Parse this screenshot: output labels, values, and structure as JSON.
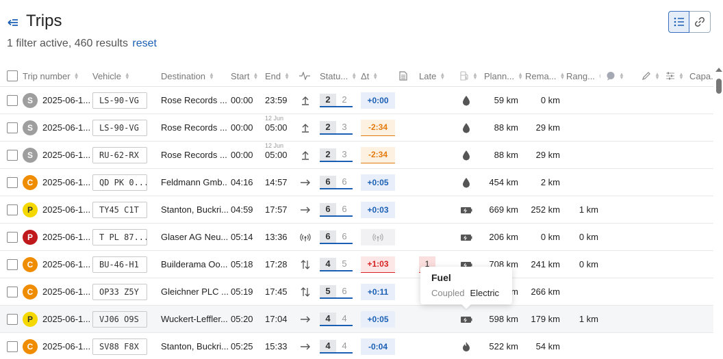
{
  "title": "Trips",
  "summary": {
    "filter_text": "1 filter active, 460 results",
    "reset_label": "reset"
  },
  "columns": {
    "trip_number": "Trip number",
    "vehicle": "Vehicle",
    "destination": "Destination",
    "start": "Start",
    "end": "End",
    "status": "Statu...",
    "delta": "Δt",
    "late": "Late",
    "planned": "Plann...",
    "remaining": "Rema...",
    "range": "Rang...",
    "capacity": "Capa..."
  },
  "rows": [
    {
      "badge": "S",
      "trip": "2025-06-1...",
      "plate": "LS-90-VG",
      "dest": "Rose Records ...",
      "start": "00:00",
      "end": "23:59",
      "end_date": "",
      "dir": "up",
      "s1": "2",
      "s2": "2",
      "delta": "+0:00",
      "delta_kind": "pos",
      "late": "",
      "fuel": "drop",
      "planned": "59 km",
      "remaining": "0 km",
      "range": ""
    },
    {
      "badge": "S",
      "trip": "2025-06-1...",
      "plate": "LS-90-VG",
      "dest": "Rose Records ...",
      "start": "00:00",
      "end": "05:00",
      "end_date": "12 Jun",
      "dir": "up",
      "s1": "2",
      "s2": "3",
      "delta": "-2:34",
      "delta_kind": "neg",
      "late": "",
      "fuel": "drop",
      "planned": "88 km",
      "remaining": "29 km",
      "range": ""
    },
    {
      "badge": "S",
      "trip": "2025-06-1...",
      "plate": "RU-62-RX",
      "dest": "Rose Records ...",
      "start": "00:00",
      "end": "05:00",
      "end_date": "12 Jun",
      "dir": "up",
      "s1": "2",
      "s2": "3",
      "delta": "-2:34",
      "delta_kind": "neg",
      "late": "",
      "fuel": "drop",
      "planned": "88 km",
      "remaining": "29 km",
      "range": ""
    },
    {
      "badge": "C",
      "trip": "2025-06-1...",
      "plate": "QD PK 0...",
      "dest": "Feldmann Gmb...",
      "start": "04:16",
      "end": "14:57",
      "end_date": "",
      "dir": "right",
      "s1": "6",
      "s2": "6",
      "delta": "+0:05",
      "delta_kind": "pos",
      "late": "",
      "fuel": "drop",
      "planned": "454 km",
      "remaining": "2 km",
      "range": ""
    },
    {
      "badge": "P",
      "trip": "2025-06-1...",
      "plate": "TY45 C1T",
      "dest": "Stanton, Buckri...",
      "start": "04:59",
      "end": "17:57",
      "end_date": "",
      "dir": "right",
      "s1": "6",
      "s2": "6",
      "delta": "+0:03",
      "delta_kind": "pos",
      "late": "",
      "fuel": "battery",
      "planned": "669 km",
      "remaining": "252 km",
      "range": "1 km"
    },
    {
      "badge": "PR",
      "label": "P",
      "trip": "2025-06-1...",
      "plate": "T PL 87...",
      "dest": "Glaser AG Neu...",
      "start": "05:14",
      "end": "13:36",
      "end_date": "",
      "dir": "signal",
      "s1": "6",
      "s2": "6",
      "delta": "",
      "delta_kind": "sig",
      "late": "",
      "fuel": "battery",
      "planned": "206 km",
      "remaining": "0 km",
      "range": "0 km"
    },
    {
      "badge": "C",
      "trip": "2025-06-1...",
      "plate": "BU-46-H1",
      "dest": "Builderama Oo...",
      "start": "05:18",
      "end": "17:28",
      "end_date": "",
      "dir": "updown",
      "s1": "4",
      "s2": "5",
      "delta": "+1:03",
      "delta_kind": "bad",
      "late": "1",
      "fuel": "battery",
      "planned": "708 km",
      "remaining": "241 km",
      "range": "0 km"
    },
    {
      "badge": "C",
      "trip": "2025-06-1...",
      "plate": "OP33 Z5Y",
      "dest": "Gleichner PLC ...",
      "start": "05:19",
      "end": "17:45",
      "end_date": "",
      "dir": "updown",
      "s1": "5",
      "s2": "6",
      "delta": "+0:11",
      "delta_kind": "pos",
      "late": "",
      "fuel": "",
      "planned": "m",
      "remaining": "266 km",
      "range": ""
    },
    {
      "badge": "P",
      "trip": "2025-06-1...",
      "plate": "VJ06 O9S",
      "dest": "Wuckert-Leffler...",
      "start": "05:20",
      "end": "17:04",
      "end_date": "",
      "dir": "right",
      "s1": "4",
      "s2": "4",
      "delta": "+0:05",
      "delta_kind": "pos",
      "late": "",
      "fuel": "battery",
      "planned": "598 km",
      "remaining": "179 km",
      "range": "1 km"
    },
    {
      "badge": "C",
      "trip": "2025-06-1...",
      "plate": "SV88 F8X",
      "dest": "Stanton, Buckri...",
      "start": "05:25",
      "end": "15:33",
      "end_date": "",
      "dir": "right",
      "s1": "4",
      "s2": "4",
      "delta": "-0:04",
      "delta_kind": "pos",
      "late": "",
      "fuel": "flame",
      "planned": "522 km",
      "remaining": "54 km",
      "range": ""
    }
  ],
  "tooltip": {
    "title": "Fuel",
    "label": "Coupled",
    "value": "Electric"
  },
  "colors": {
    "accent": "#1a5fb4",
    "orange": "#ef8c00",
    "red": "#d71f1f"
  }
}
